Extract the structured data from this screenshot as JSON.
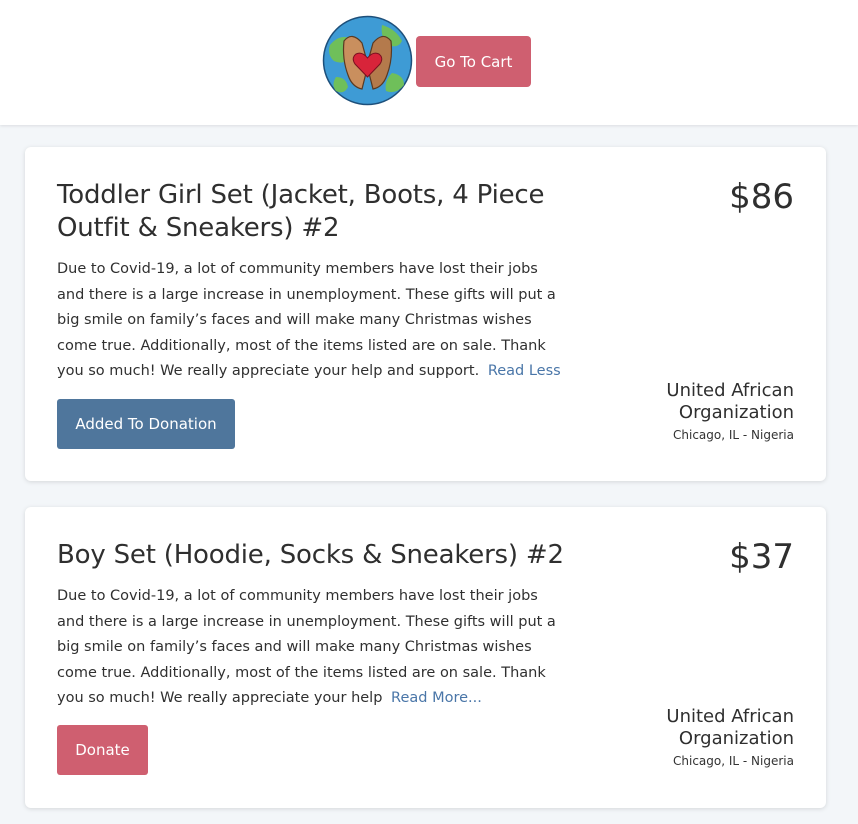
{
  "header": {
    "cart_label": "Go To Cart"
  },
  "items": [
    {
      "title": "Toddler Girl Set (Jacket, Boots, 4 Piece Outfit & Sneakers) #2",
      "description": "Due to Covid-19, a lot of community members have lost their jobs and there is a large increase in unemployment. These gifts will put a big smile on family’s faces and will make many Christmas wishes come true. Additionally, most of the items listed are on sale. Thank you so much! We really appreciate your help and support.",
      "read_link": "Read Less",
      "price": "$86",
      "org_name": "United African Organization",
      "org_location": "Chicago, IL - Nigeria",
      "button_label": "Added To Donation"
    },
    {
      "title": "Boy Set (Hoodie, Socks & Sneakers) #2",
      "description": "Due to Covid-19, a lot of community members have lost their jobs and there is a large increase in unemployment. These gifts will put a big smile on family’s faces and will make many Christmas wishes come true. Additionally, most of the items listed are on sale. Thank you so much! We really appreciate your help",
      "read_link": "Read More...",
      "price": "$37",
      "org_name": "United African Organization",
      "org_location": "Chicago, IL - Nigeria",
      "button_label": "Donate"
    }
  ],
  "colors": {
    "accent_pink": "#cf5f70",
    "accent_blue": "#4f769c",
    "link_blue": "#4a76a8",
    "background": "#f3f6f9"
  },
  "icons": {
    "logo": "globe-hands-heart-logo"
  }
}
